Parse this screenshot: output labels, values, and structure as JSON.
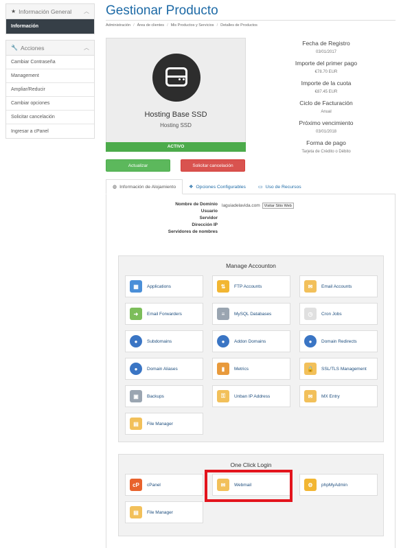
{
  "sidebar": {
    "info_panel": {
      "title": "Información General",
      "items": [
        {
          "label": "Información"
        }
      ]
    },
    "actions_panel": {
      "title": "Acciones",
      "items": [
        {
          "label": "Cambiar Contraseña"
        },
        {
          "label": "Management"
        },
        {
          "label": "Ampliar/Reducir"
        },
        {
          "label": "Cambiar opciones"
        },
        {
          "label": "Solicitar cancelación"
        },
        {
          "label": "Ingresar a cPanel"
        }
      ]
    }
  },
  "header": {
    "title": "Gestionar Producto",
    "breadcrumb": [
      "Administración",
      "Área de clientes",
      "Mis Productos y Servicios",
      "Detalles de Productos"
    ]
  },
  "product": {
    "name": "Hosting Base SSD",
    "group": "Hosting SSD",
    "status": "ACTIVO"
  },
  "buttons": {
    "upgrade": "Actualizar",
    "cancel": "Solicitar cancelación"
  },
  "details": [
    {
      "label": "Fecha de Registro",
      "value": "03/01/2017"
    },
    {
      "label": "Importe del primer pago",
      "value": "€78.70 EUR"
    },
    {
      "label": "Importe de la cuota",
      "value": "€87.45 EUR"
    },
    {
      "label": "Ciclo de Facturación",
      "value": "Anual"
    },
    {
      "label": "Próximo vencimiento",
      "value": "03/01/2018"
    },
    {
      "label": "Forma de pago",
      "value": "Tarjeta de Crédito o Débito"
    }
  ],
  "tabs": [
    {
      "label": "Información de Alojamiento",
      "icon": "globe-icon"
    },
    {
      "label": "Opciones Configurables",
      "icon": "cubes-icon"
    },
    {
      "label": "Uso de Recursos",
      "icon": "hdd-icon"
    }
  ],
  "hosting": {
    "domain_label": "Nombre de Dominio",
    "domain_value": "laguiadelavida.com",
    "visit_button": "Visitar Sitio Web",
    "user_label": "Usuario",
    "server_label": "Servidor",
    "ip_label": "Dirección IP",
    "ns_label": "Servidores de nombres"
  },
  "manage": {
    "title": "Manage Accounton",
    "items": [
      {
        "label": "Applications",
        "icon": "applications-icon",
        "color": "#4a8fd8"
      },
      {
        "label": "FTP Accounts",
        "icon": "ftp-icon",
        "color": "#f2b632"
      },
      {
        "label": "Email Accounts",
        "icon": "email-icon",
        "color": "#f2c05a"
      },
      {
        "label": "Email Forwarders",
        "icon": "email-forward-icon",
        "color": "#7cbd5a"
      },
      {
        "label": "MySQL Databases",
        "icon": "database-icon",
        "color": "#9aa5b1"
      },
      {
        "label": "Cron Jobs",
        "icon": "cron-icon",
        "color": "#e0e0e0"
      },
      {
        "label": "Subdomains",
        "icon": "subdomain-icon",
        "color": "#3a75c4"
      },
      {
        "label": "Addon Domains",
        "icon": "addon-domain-icon",
        "color": "#3a75c4"
      },
      {
        "label": "Domain Redirects",
        "icon": "redirect-icon",
        "color": "#3a75c4"
      },
      {
        "label": "Domain Aliases",
        "icon": "alias-icon",
        "color": "#3a75c4"
      },
      {
        "label": "Metrics",
        "icon": "metrics-icon",
        "color": "#e89a3c"
      },
      {
        "label": "SSL/TLS Management",
        "icon": "ssl-icon",
        "color": "#f2c05a"
      },
      {
        "label": "Backups",
        "icon": "backup-icon",
        "color": "#9aa5b1"
      },
      {
        "label": "Unban IP Address",
        "icon": "unban-icon",
        "color": "#f2c05a"
      },
      {
        "label": "MX Entry",
        "icon": "mx-icon",
        "color": "#f2c05a"
      },
      {
        "label": "File Manager",
        "icon": "file-manager-icon",
        "color": "#f2c05a"
      }
    ]
  },
  "one_click": {
    "title": "One Click Login",
    "items": [
      {
        "label": "cPanel",
        "icon": "cpanel-icon",
        "color": "#e8622c"
      },
      {
        "label": "Webmail",
        "icon": "webmail-icon",
        "color": "#f2c05a"
      },
      {
        "label": "phpMyAdmin",
        "icon": "phpmyadmin-icon",
        "color": "#f2b632"
      },
      {
        "label": "File Manager",
        "icon": "file-manager-icon",
        "color": "#f2c05a"
      }
    ]
  }
}
